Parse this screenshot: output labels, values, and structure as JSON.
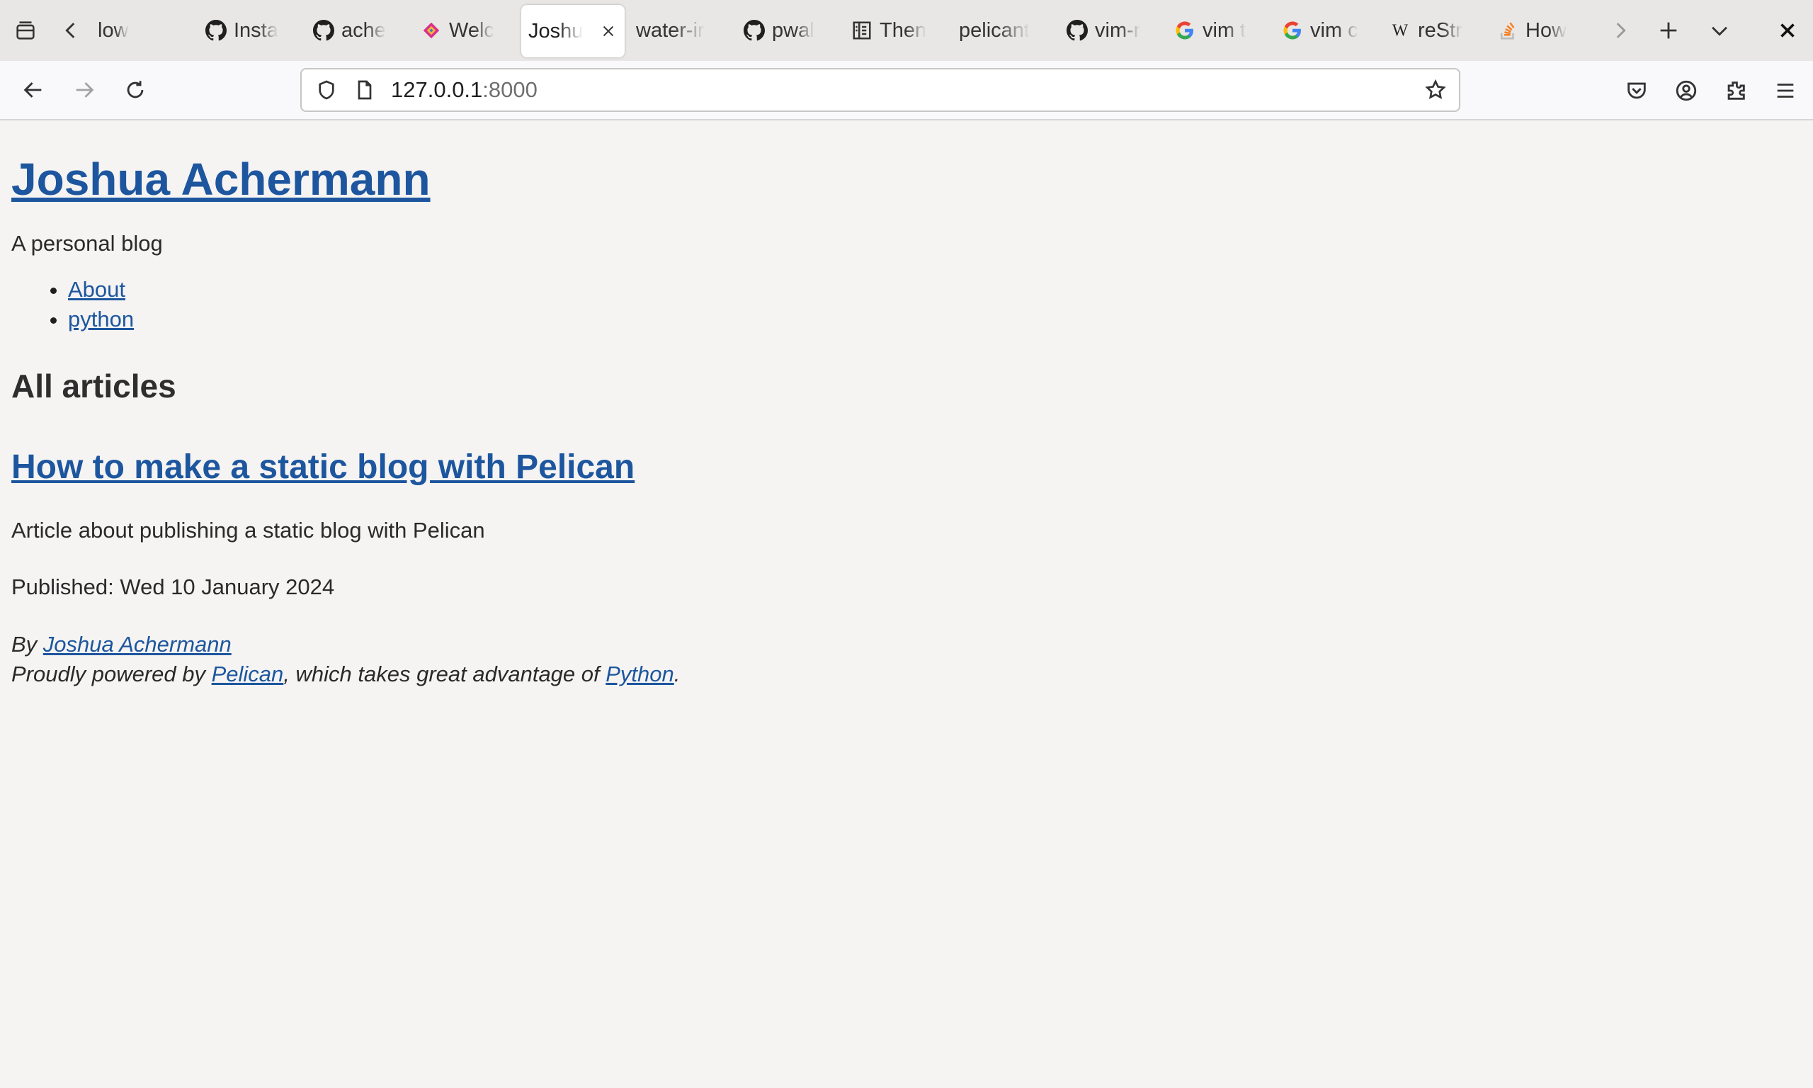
{
  "browser": {
    "tabs": [
      {
        "label": "low",
        "icon": "none",
        "active": false
      },
      {
        "label": "Insta",
        "icon": "github-icon",
        "active": false
      },
      {
        "label": "ache",
        "icon": "github-icon",
        "active": false
      },
      {
        "label": "Welc",
        "icon": "diamond-icon",
        "active": false
      },
      {
        "label": "Joshu",
        "icon": "none",
        "active": true
      },
      {
        "label": "water-ir",
        "icon": "none",
        "active": false
      },
      {
        "label": "pwal",
        "icon": "github-icon",
        "active": false
      },
      {
        "label": "Then",
        "icon": "reader-icon",
        "active": false
      },
      {
        "label": "pelicant",
        "icon": "none",
        "active": false
      },
      {
        "label": "vim-r",
        "icon": "github-icon",
        "active": false
      },
      {
        "label": "vim t",
        "icon": "google-icon",
        "active": false
      },
      {
        "label": "vim c",
        "icon": "google-icon",
        "active": false
      },
      {
        "label": "reStr",
        "icon": "wikipedia-icon",
        "active": false
      },
      {
        "label": "How",
        "icon": "stackoverflow-icon",
        "active": false
      }
    ],
    "url": {
      "host": "127.0.0.1",
      "port": ":8000"
    },
    "colors": {
      "tabstrip_bg": "#e9e7e5",
      "page_bg": "#f5f4f3",
      "link": "#1d569e"
    }
  },
  "page": {
    "site_title": "Joshua Achermann",
    "tagline": "A personal blog",
    "menu": [
      {
        "label": "About"
      },
      {
        "label": "python"
      }
    ],
    "section_heading": "All articles",
    "article": {
      "title": "How to make a static blog with Pelican",
      "summary": "Article about publishing a static blog with Pelican",
      "published": "Published: Wed 10 January 2024"
    },
    "footer": {
      "by_prefix": "By ",
      "author": "Joshua Achermann",
      "powered_prefix": "Proudly powered by ",
      "pelican": "Pelican",
      "powered_middle": ", which takes great advantage of ",
      "python": "Python",
      "powered_suffix": "."
    }
  }
}
